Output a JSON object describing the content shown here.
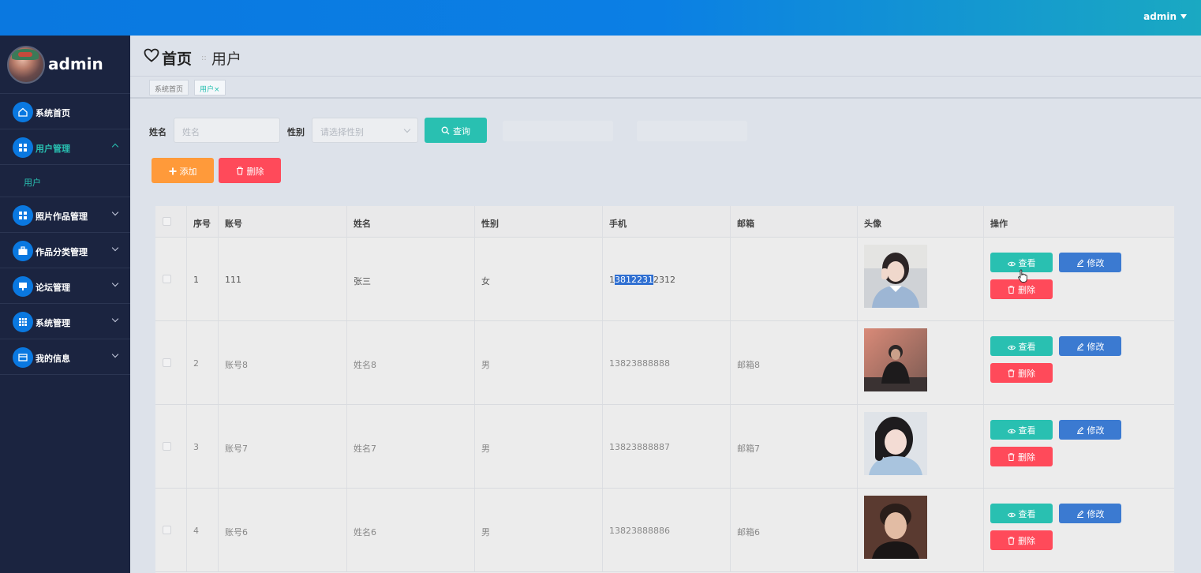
{
  "topbar": {
    "user": "admin"
  },
  "sidebar": {
    "user_name": "admin",
    "items": [
      {
        "label": "系统首页",
        "icon": "home-icon"
      },
      {
        "label": "用户管理",
        "icon": "grid-icon",
        "expanded": true,
        "sub": [
          {
            "label": "用户"
          }
        ]
      },
      {
        "label": "照片作品管理",
        "icon": "grid-icon"
      },
      {
        "label": "作品分类管理",
        "icon": "briefcase-icon"
      },
      {
        "label": "论坛管理",
        "icon": "monitor-icon"
      },
      {
        "label": "系统管理",
        "icon": "table-icon"
      },
      {
        "label": "我的信息",
        "icon": "card-icon"
      }
    ]
  },
  "header": {
    "title": "首页",
    "separator": "::",
    "subtitle": "用户"
  },
  "tags": [
    {
      "label": "系统首页"
    },
    {
      "label": "用户×"
    }
  ],
  "search": {
    "name_label": "姓名",
    "name_placeholder": "姓名",
    "gender_label": "性别",
    "gender_placeholder": "请选择性别",
    "query_label": "查询"
  },
  "actions": {
    "add_label": "添加",
    "delete_label": "删除"
  },
  "table": {
    "columns": [
      "序号",
      "账号",
      "姓名",
      "性别",
      "手机",
      "邮箱",
      "头像",
      "操作"
    ],
    "row_actions": {
      "view": "查看",
      "edit": "修改",
      "delete": "删除"
    },
    "rows": [
      {
        "index": "1",
        "account": "111",
        "name": "张三",
        "gender": "女",
        "phone_pre": "1",
        "phone_sel": "3812231",
        "phone_post": "2312",
        "email": ""
      },
      {
        "index": "2",
        "account": "账号8",
        "name": "姓名8",
        "gender": "男",
        "phone": "13823888888",
        "email": "邮箱8"
      },
      {
        "index": "3",
        "account": "账号7",
        "name": "姓名7",
        "gender": "男",
        "phone": "13823888887",
        "email": "邮箱7"
      },
      {
        "index": "4",
        "account": "账号6",
        "name": "姓名6",
        "gender": "男",
        "phone": "13823888886",
        "email": "邮箱6"
      }
    ]
  },
  "colors": {
    "primary": "#0a78e0",
    "teal": "#29c0b1",
    "orange": "#ff9a3a",
    "red": "#ff4a5a",
    "blue": "#3b7ad1",
    "sidebar": "#1b2440"
  }
}
